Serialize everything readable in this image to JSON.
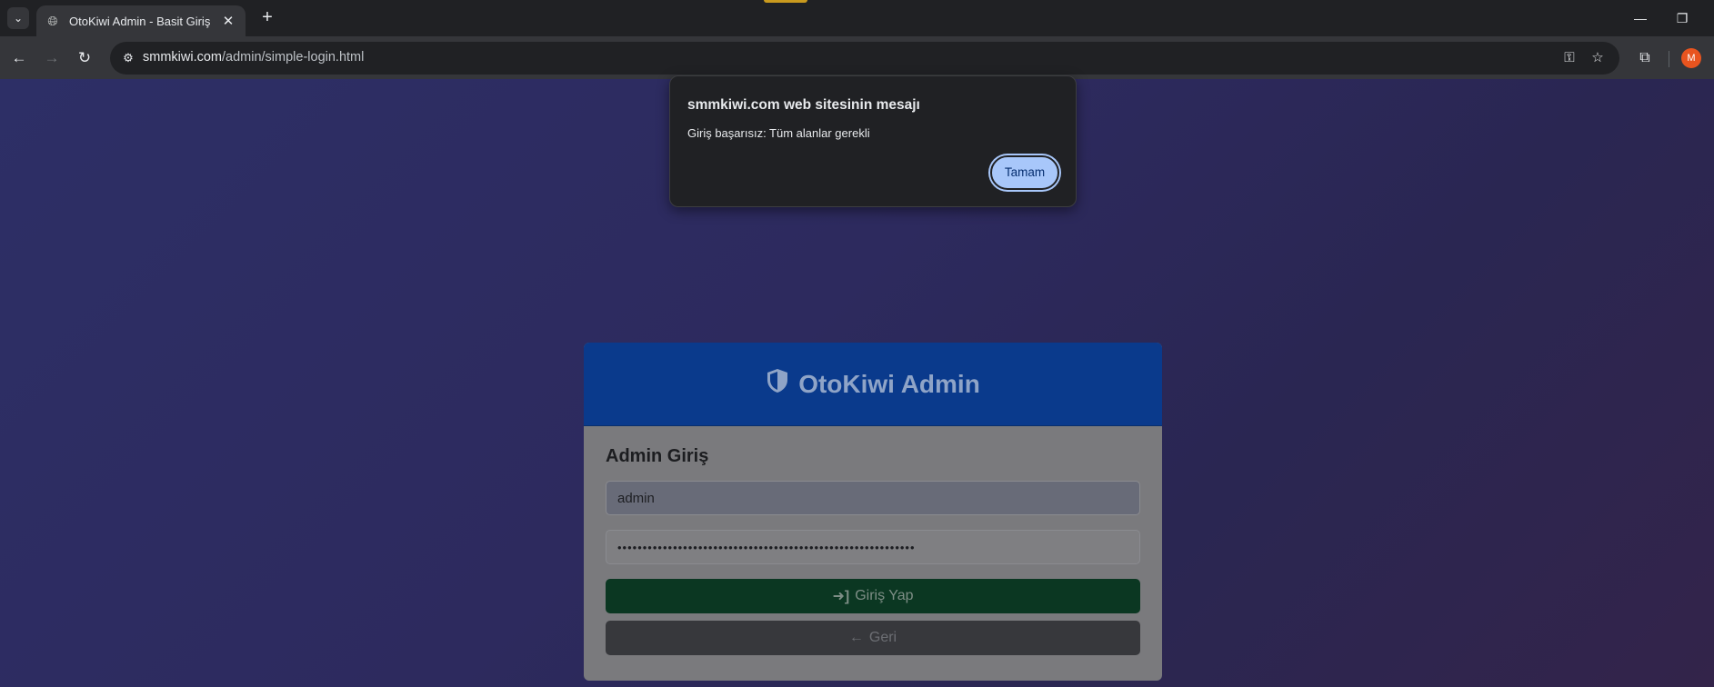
{
  "browser": {
    "tab": {
      "title": "OtoKiwi Admin - Basit Giriş"
    },
    "url": {
      "host": "smmkiwi.com",
      "path": "/admin/simple-login.html"
    },
    "profile_initial": "M"
  },
  "card": {
    "brand": "OtoKiwi Admin",
    "heading": "Admin Giriş",
    "username_value": "admin",
    "password_mask": "•••••••••••••••••••••••••••••••••••••••••••••••••••••••••••",
    "login_label": "Giriş Yap",
    "back_label": "Geri"
  },
  "dialog": {
    "title": "smmkiwi.com web sitesinin mesajı",
    "message": "Giriş başarısız: Tüm alanlar gerekli",
    "ok_label": "Tamam"
  },
  "icons": {
    "tab_favicon": "globe-icon",
    "card_header": "shield-icon",
    "login": "sign-in-icon",
    "back": "arrow-left-icon"
  },
  "colors": {
    "header_blue": "#0a3a8c",
    "login_green": "#0b3722",
    "dialog_button": "#a8c7fa"
  }
}
